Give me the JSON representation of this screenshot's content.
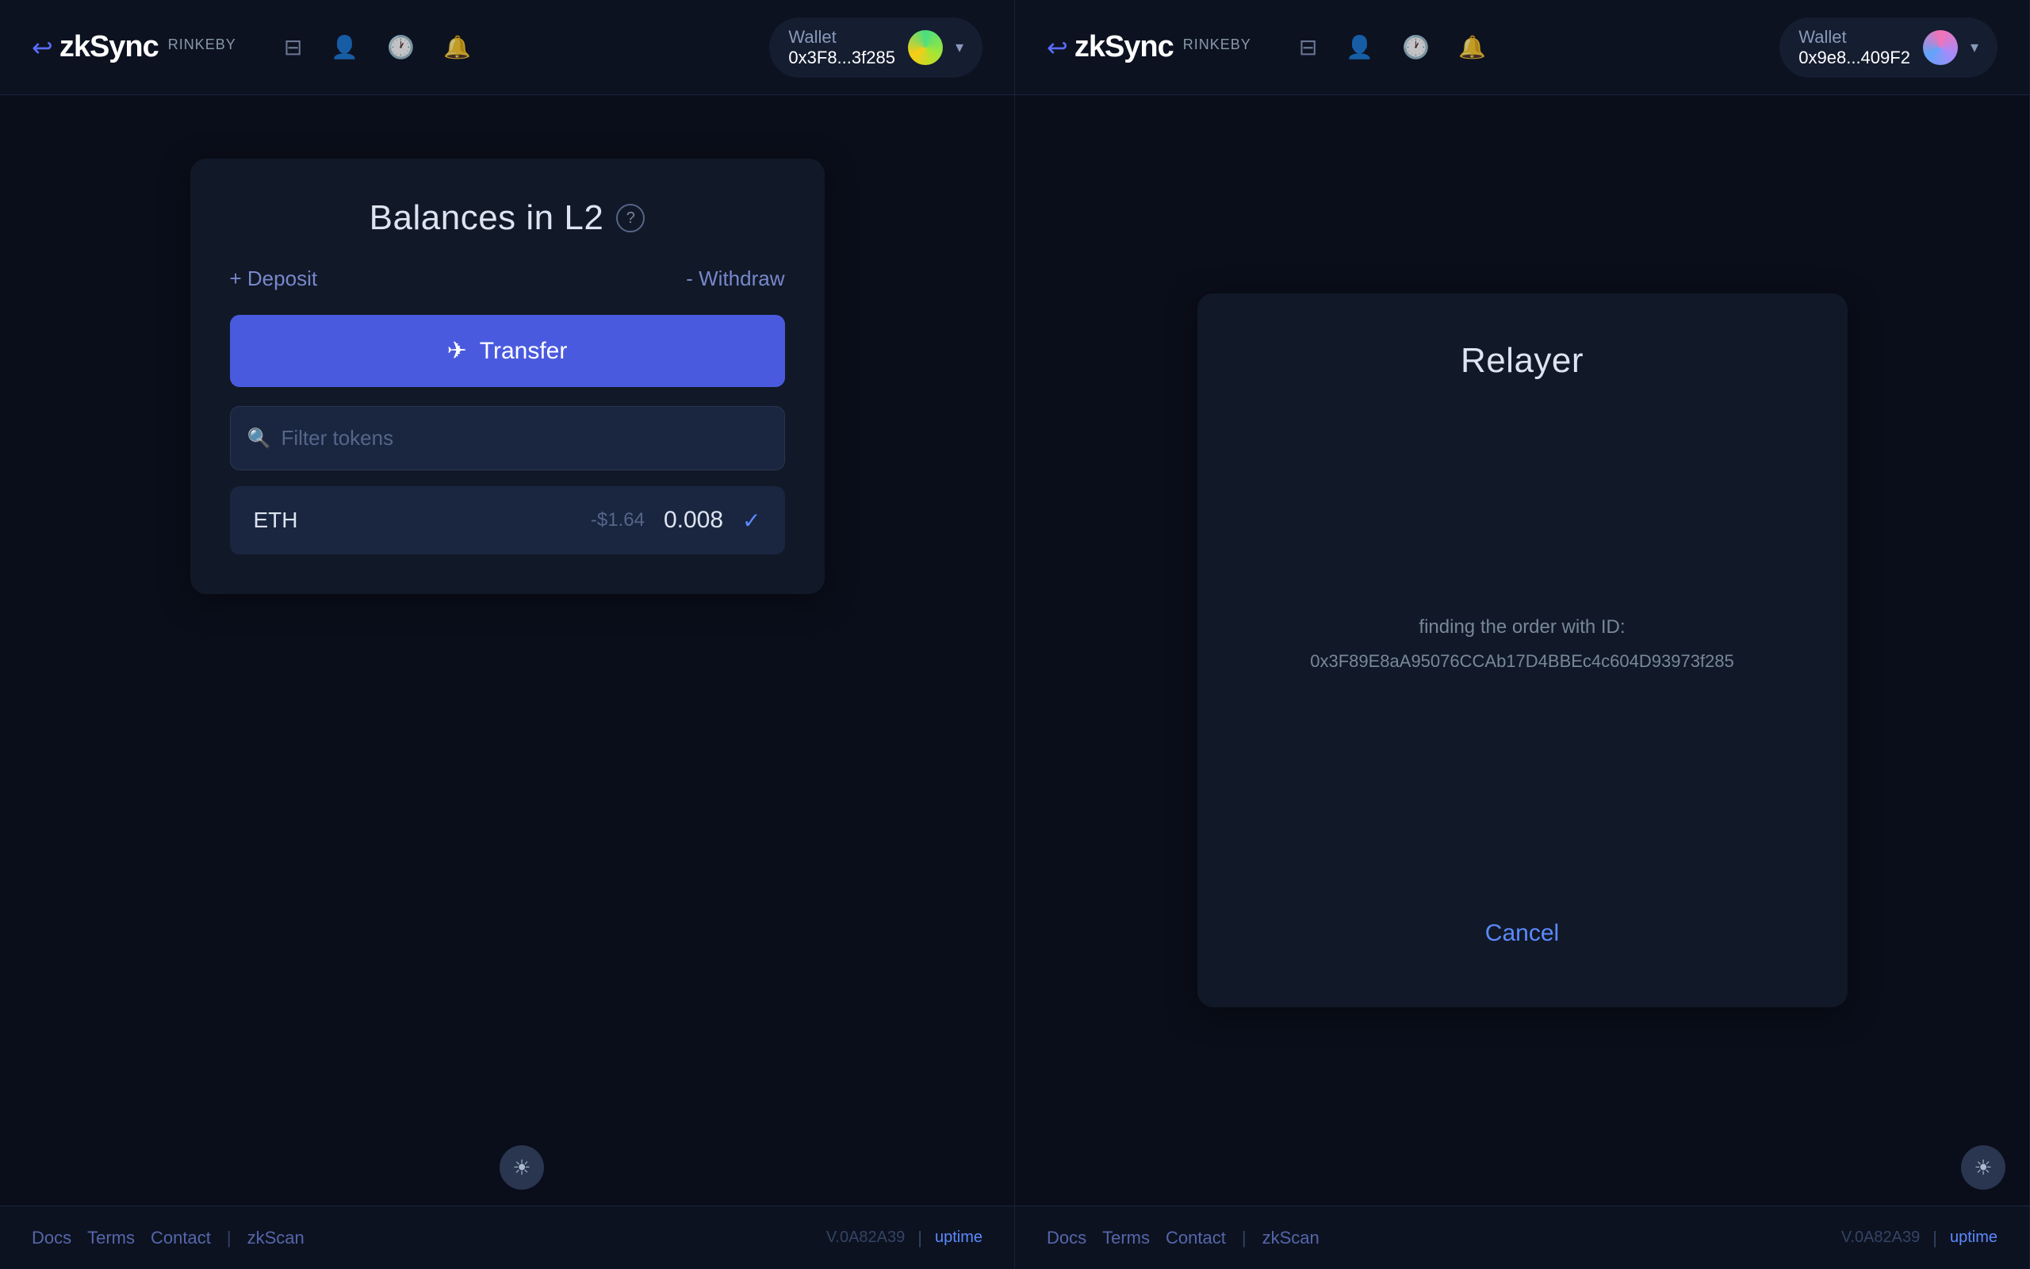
{
  "left_panel": {
    "navbar": {
      "logo": "zkSync",
      "network": "RINKEBY",
      "wallet_label": "Wallet",
      "wallet_address": "0x3F8...3f285",
      "icons": [
        "wallet-icon",
        "contacts-icon",
        "history-icon",
        "bell-icon"
      ]
    },
    "balances_card": {
      "title": "Balances in L2",
      "deposit_label": "+ Deposit",
      "withdraw_label": "- Withdraw",
      "transfer_label": "Transfer",
      "filter_placeholder": "Filter tokens",
      "tokens": [
        {
          "name": "ETH",
          "price": "-$1.64",
          "amount": "0.008",
          "selected": true
        }
      ]
    },
    "footer": {
      "docs_label": "Docs",
      "terms_label": "Terms",
      "contact_label": "Contact",
      "zkscan_label": "zkScan",
      "version": "V.0A82A39",
      "uptime_label": "uptime"
    }
  },
  "right_panel": {
    "navbar": {
      "logo": "zkSync",
      "network": "RINKEBY",
      "wallet_label": "Wallet",
      "wallet_address": "0x9e8...409F2",
      "icons": [
        "wallet-icon",
        "contacts-icon",
        "history-icon",
        "bell-icon"
      ]
    },
    "relayer_card": {
      "title": "Relayer",
      "finding_text": "finding the order with ID:",
      "order_id": "0x3F89E8aA95076CCAb17D4BBEc4c604D93973f285",
      "cancel_label": "Cancel"
    },
    "footer": {
      "docs_label": "Docs",
      "terms_label": "Terms",
      "contact_label": "Contact",
      "zkscan_label": "zkScan",
      "version": "V.0A82A39",
      "uptime_label": "uptime"
    }
  },
  "theme_toggle": "☀"
}
